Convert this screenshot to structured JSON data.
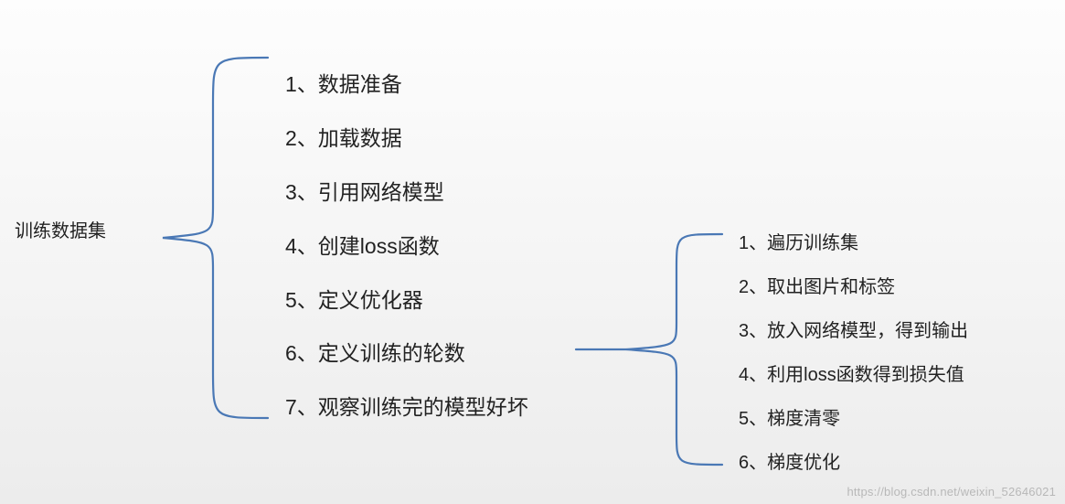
{
  "root": {
    "label": "训练数据集"
  },
  "steps": {
    "items": [
      {
        "text": "1、数据准备"
      },
      {
        "text": "2、加载数据"
      },
      {
        "text": "3、引用网络模型"
      },
      {
        "text": "4、创建loss函数"
      },
      {
        "text": "5、定义优化器"
      },
      {
        "text": "6、定义训练的轮数"
      },
      {
        "text": "7、观察训练完的模型好坏"
      }
    ]
  },
  "loop": {
    "items": [
      {
        "text": "1、遍历训练集"
      },
      {
        "text": "2、取出图片和标签"
      },
      {
        "text": "3、放入网络模型，得到输出"
      },
      {
        "text": "4、利用loss函数得到损失值"
      },
      {
        "text": "5、梯度清零"
      },
      {
        "text": "6、梯度优化"
      }
    ]
  },
  "watermark": {
    "text": "https://blog.csdn.net/weixin_52646021"
  }
}
